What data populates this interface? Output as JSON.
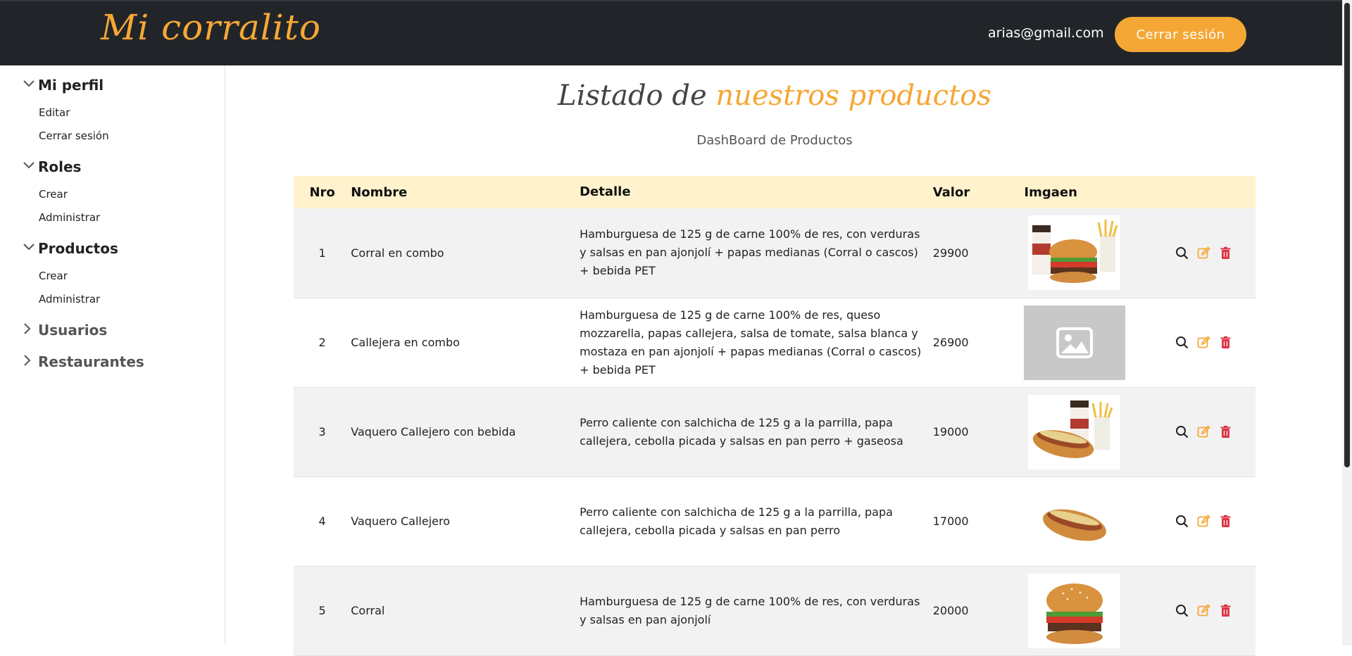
{
  "header": {
    "brand": "Mi corralito",
    "user_email": "arias@gmail.com",
    "logout_label": "Cerrar sesión"
  },
  "sidebar": {
    "sections": [
      {
        "label": "Mi perfil",
        "expanded": true,
        "items": [
          "Editar",
          "Cerrar sesión"
        ]
      },
      {
        "label": "Roles",
        "expanded": true,
        "items": [
          "Crear",
          "Administrar"
        ]
      },
      {
        "label": "Productos",
        "expanded": true,
        "items": [
          "Crear",
          "Administrar"
        ]
      },
      {
        "label": "Usuarios",
        "expanded": false,
        "items": []
      },
      {
        "label": "Restaurantes",
        "expanded": false,
        "items": []
      }
    ]
  },
  "main": {
    "title_prefix": "Listado de",
    "title_highlight": "nuestros productos",
    "subtitle": "DashBoard de Productos",
    "columns": [
      "Nro",
      "Nombre",
      "Detalle",
      "Valor",
      "Imgaen"
    ],
    "rows": [
      {
        "nro": "1",
        "nombre": "Corral en combo",
        "detalle": "Hamburguesa de 125 g de carne 100% de res, con verduras y salsas en pan ajonjolí + papas medianas (Corral o cascos) + bebida PET",
        "valor": "29900",
        "image": "burger-combo-image"
      },
      {
        "nro": "2",
        "nombre": "Callejera en combo",
        "detalle": "Hamburguesa de 125 g de carne 100% de res, queso mozzarella, papas callejera, salsa de tomate, salsa blanca y mostaza en pan ajonjolí + papas medianas (Corral o cascos) + bebida PET",
        "valor": "26900",
        "image": "image-placeholder"
      },
      {
        "nro": "3",
        "nombre": "Vaquero Callejero con bebida",
        "detalle": "Perro caliente con salchicha de 125 g a la parrilla, papa callejera, cebolla picada y salsas en pan perro + gaseosa",
        "valor": "19000",
        "image": "hotdog-combo-image"
      },
      {
        "nro": "4",
        "nombre": "Vaquero Callejero",
        "detalle": "Perro caliente con salchicha de 125 g a la parrilla, papa callejera, cebolla picada y salsas en pan perro",
        "valor": "17000",
        "image": "hotdog-image"
      },
      {
        "nro": "5",
        "nombre": "Corral",
        "detalle": "Hamburguesa de 125 g de carne 100% de res, con verduras y salsas en pan ajonjolí",
        "valor": "20000",
        "image": "burger-image"
      }
    ]
  },
  "colors": {
    "accent": "#f5a735",
    "topbar": "#212529",
    "table_header": "#fff2cc",
    "view_icon": "#222222",
    "edit_icon": "#f5a735",
    "delete_icon": "#dc3545"
  }
}
